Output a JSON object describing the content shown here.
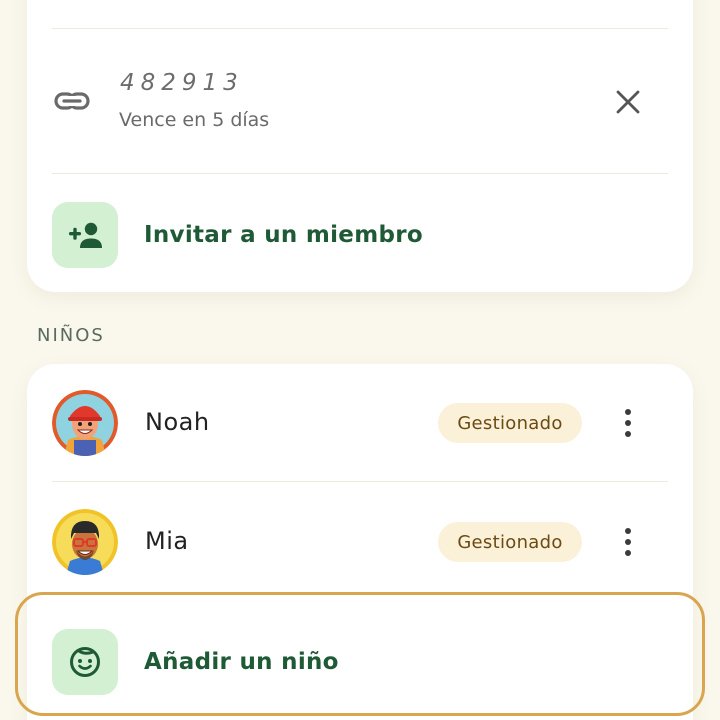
{
  "invite": {
    "code": "482913",
    "expires_label": "Vence en 5 días",
    "link_icon": "link-icon",
    "close_icon": "close-icon"
  },
  "invite_member": {
    "label": "Invitar a un miembro",
    "icon": "person-add-icon"
  },
  "kids_section": {
    "title": "NIÑOS",
    "items": [
      {
        "name": "Noah",
        "badge": "Gestionado",
        "avatar": "avatar-noah"
      },
      {
        "name": "Mia",
        "badge": "Gestionado",
        "avatar": "avatar-mia"
      }
    ]
  },
  "add_child": {
    "label": "Añadir un niño",
    "icon": "child-face-icon"
  },
  "colors": {
    "background": "#faf7ec",
    "accent_green": "#1f5a36",
    "icon_bg_green": "#d3f0d2",
    "badge_bg": "#fbf0d8",
    "badge_text": "#6b4b12",
    "highlight_border": "#d9a64f"
  }
}
